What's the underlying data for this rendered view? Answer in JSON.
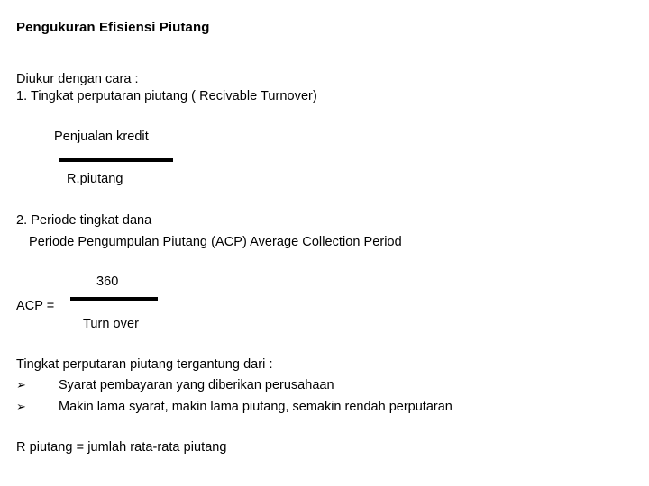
{
  "slide": {
    "title": "Pengukuran Efisiensi Piutang",
    "intro": {
      "line1": "Diukur dengan cara :",
      "line2": "1. Tingkat perputaran piutang ( Recivable Turnover)"
    },
    "formula_turnover": {
      "numerator": "Penjualan kredit",
      "denominator": "R.piutang"
    },
    "section_two": {
      "line1": "2. Periode tingkat dana",
      "line2": "Periode Pengumpulan Piutang (ACP) Average Collection Period"
    },
    "formula_acp": {
      "label": "ACP =",
      "numerator": "360",
      "denominator": "Turn over"
    },
    "depends": {
      "heading": "Tingkat perputaran piutang tergantung dari :",
      "bullet_glyph": "➢",
      "items": [
        "Syarat pembayaran yang diberikan perusahaan",
        "Makin lama syarat, makin lama piutang, semakin rendah perputaran"
      ]
    },
    "closing": "R piutang = jumlah rata-rata piutang",
    "colors": {
      "background": "#ffffff",
      "text": "#000000",
      "rule": "#000000"
    }
  }
}
